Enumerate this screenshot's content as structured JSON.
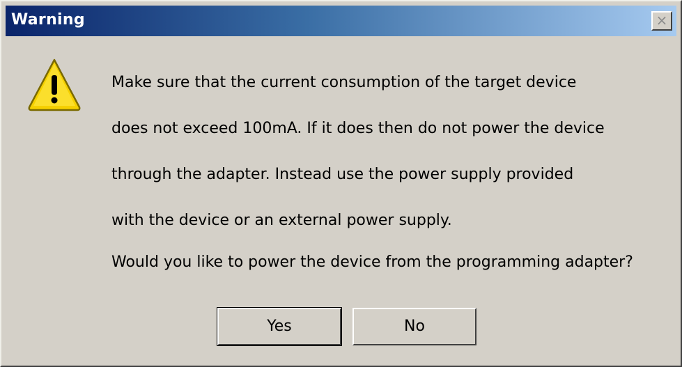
{
  "window": {
    "title": "Warning",
    "close_label": "×"
  },
  "icon": {
    "name": "warning-icon",
    "color": "#f5d000"
  },
  "message": {
    "lines": [
      "Make sure that the current consumption of the target device",
      "does not exceed 100mA. If it does then do not power the device",
      "through the adapter. Instead use the power supply provided",
      "with the device or an external power supply."
    ],
    "question": "Would you like to power the device from the programming adapter?"
  },
  "buttons": {
    "yes_label": "Yes",
    "no_label": "No"
  }
}
